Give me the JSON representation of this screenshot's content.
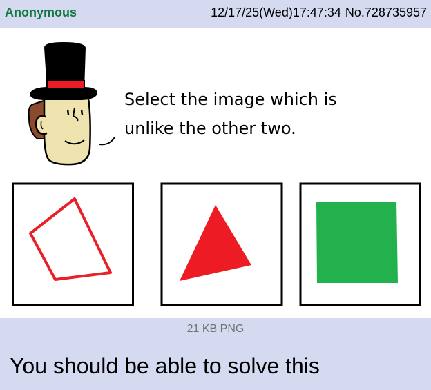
{
  "post": {
    "name": "Anonymous",
    "datetime": "12/17/25(Wed)17:47:34",
    "post_no": "No.728735957",
    "file_info": "21 KB PNG",
    "comment": "You should be able to solve this"
  },
  "image": {
    "caption_line1": "Select the image which is",
    "caption_line2": "unlike the other two.",
    "choices": [
      {
        "shape": "quadrilateral-outline",
        "color": "#e8202a"
      },
      {
        "shape": "triangle-filled",
        "color": "#ed1c24"
      },
      {
        "shape": "square-filled",
        "color": "#22b14c"
      }
    ]
  },
  "colors": {
    "post_bg": "#d6daf0",
    "name_green": "#117743",
    "hat_band": "#ed1c24",
    "hair": "#8b4a2b",
    "skin": "#efe4b0"
  }
}
